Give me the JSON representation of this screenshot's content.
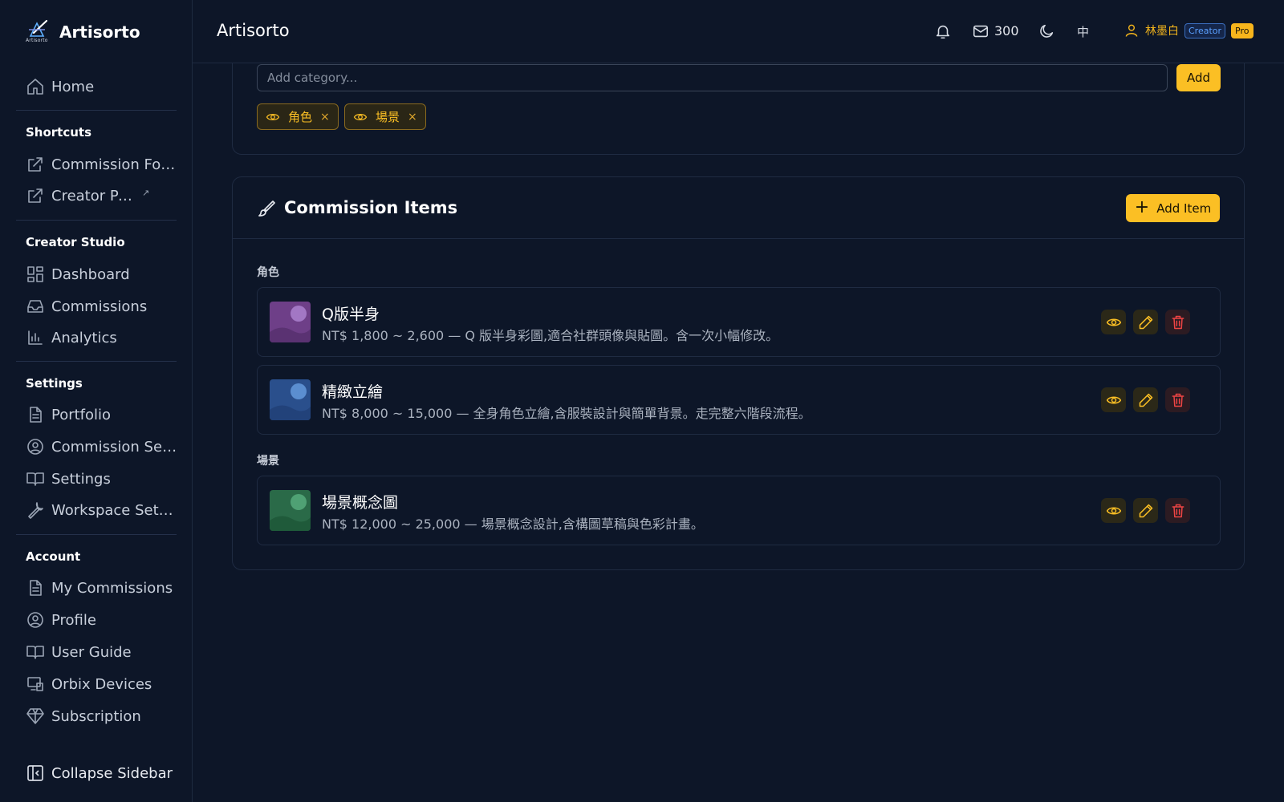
{
  "app": {
    "brand": "Artisorto",
    "logo_sub": "Artisorto"
  },
  "header": {
    "title": "Artisorto",
    "mail_count": "300",
    "language": "中",
    "user_name": "林墨白",
    "badge_creator": "Creator",
    "badge_pro": "Pro",
    "icons": [
      "bell-icon",
      "mail-icon",
      "moon-icon",
      "user-icon"
    ]
  },
  "sidebar": {
    "home": "Home",
    "sections": {
      "shortcuts": "Shortcuts",
      "creator_studio": "Creator Studio",
      "settings": "Settings",
      "account": "Account"
    },
    "shortcuts": [
      "Commission Form",
      "Creator Page"
    ],
    "creator_studio": [
      "Dashboard",
      "Commissions",
      "Analytics"
    ],
    "settings": [
      "Portfolio",
      "Commission Settings",
      "Settings",
      "Workspace Settings"
    ],
    "account": [
      "My Commissions",
      "Profile",
      "User Guide",
      "Orbix Devices",
      "Subscription"
    ],
    "collapse": "Collapse Sidebar"
  },
  "categories": {
    "placeholder": "Add category...",
    "add_label": "Add",
    "chips": [
      "角色",
      "場景"
    ],
    "remove_symbol": "×"
  },
  "items": {
    "title": "Commission Items",
    "add_item_label": "Add Item",
    "groups": [
      {
        "label": "角色",
        "items": [
          {
            "name": "Q版半身",
            "desc": "NT$ 1,800 ~ 2,600 — Q 版半身彩圖,適合社群頭像與貼圖。含一次小幅修改。",
            "thumb_color": "#7c4a96"
          },
          {
            "name": "精緻立繪",
            "desc": "NT$ 8,000 ~ 15,000 — 全身角色立繪,含服裝設計與簡單背景。走完整六階段流程。",
            "thumb_color": "#2f5aa0"
          }
        ]
      },
      {
        "label": "場景",
        "items": [
          {
            "name": "場景概念圖",
            "desc": "NT$ 12,000 ~ 25,000 — 場景概念設計,含構圖草稿與色彩計畫。",
            "thumb_color": "#2f7a52"
          }
        ]
      }
    ]
  },
  "colors": {
    "accent": "#fbbf24",
    "danger": "#ef4444",
    "background": "#0d1628",
    "border": "#1f2b42"
  }
}
